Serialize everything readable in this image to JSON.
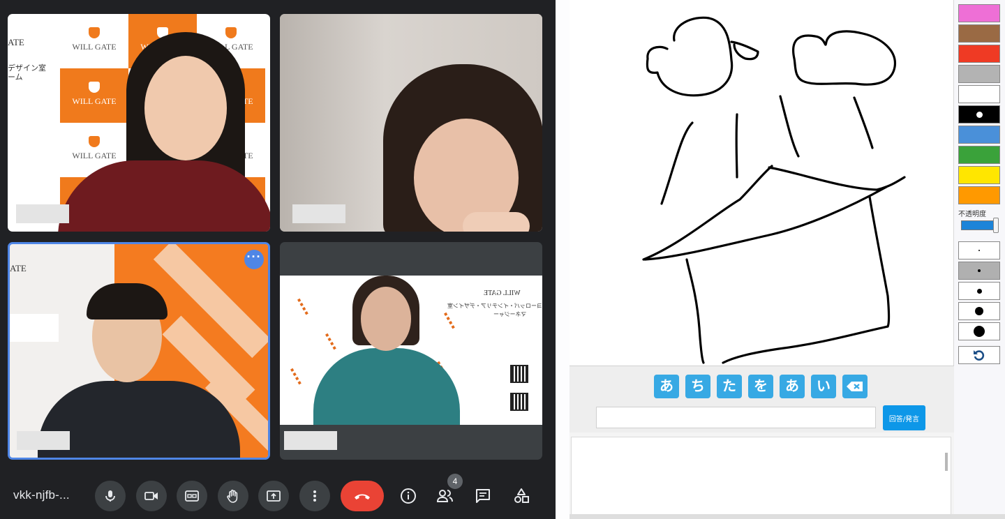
{
  "meeting": {
    "code": "vkk-njfb-...",
    "participant_count": "4",
    "tiles": [
      {
        "backdrop_brand": "WILL GATE",
        "side_text": [
          "ATE",
          "デザイン室",
          "ーム"
        ]
      },
      {},
      {
        "side_text": [
          "ATE"
        ]
      },
      {
        "backdrop_words": [
          "WILL GATE",
          "ヨーロッパ・インテリア・デザイン室",
          "マネージャー"
        ]
      }
    ]
  },
  "toolbar": {
    "icons": [
      "microphone-icon",
      "camera-icon",
      "captions-icon",
      "raise-hand-icon",
      "present-screen-icon",
      "more-options-icon",
      "end-call-icon",
      "info-icon",
      "people-icon",
      "chat-icon",
      "activities-icon"
    ]
  },
  "drawing_app": {
    "kana_keys": [
      "あ",
      "ち",
      "た",
      "を",
      "あ",
      "い"
    ],
    "answer_input": {
      "value": "",
      "placeholder": ""
    },
    "answer_button_label": "回答/発言",
    "opacity_label": "不透明度",
    "palette_colors": [
      "#ee6fd6",
      "#9a6a44",
      "#ef3a24",
      "#b3b3b3",
      "#ffffff",
      "#000000",
      "#4a90d9",
      "#3aa23a",
      "#ffe600",
      "#ff9900"
    ],
    "brush_sizes": [
      2,
      4,
      7,
      12,
      16
    ],
    "opacity": 0.9
  }
}
